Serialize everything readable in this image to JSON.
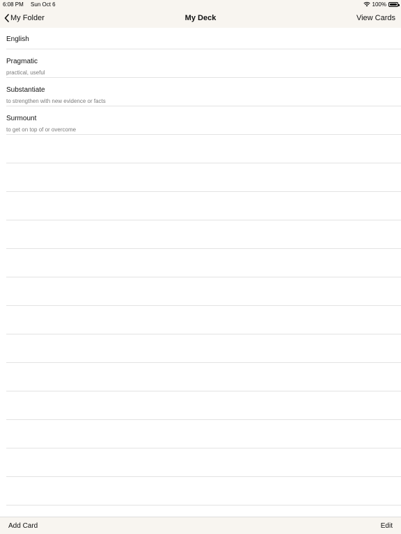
{
  "status": {
    "time": "6:08 PM",
    "date": "Sun Oct 6",
    "battery": "100%",
    "wifi_icon": "wifi-icon",
    "battery_icon": "battery-icon"
  },
  "nav": {
    "back_label": "My Folder",
    "title": "My Deck",
    "right_label": "View Cards",
    "back_icon": "chevron-left-icon"
  },
  "cards": [
    {
      "title": "English",
      "subtitle": ""
    },
    {
      "title": "Pragmatic",
      "subtitle": "practical, useful"
    },
    {
      "title": "Substantiate",
      "subtitle": "to strengthen with new evidence or facts"
    },
    {
      "title": "Surmount",
      "subtitle": "to get on top of or overcome"
    }
  ],
  "toolbar": {
    "add_label": "Add Card",
    "edit_label": "Edit"
  }
}
